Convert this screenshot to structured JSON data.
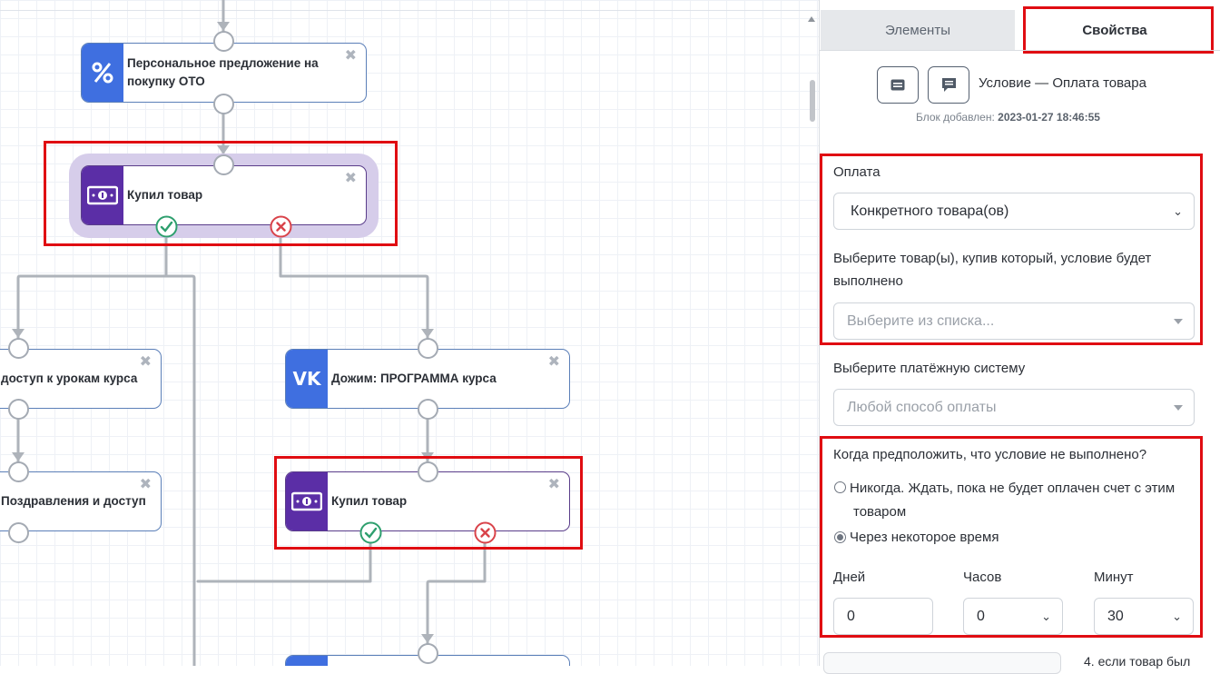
{
  "canvas": {
    "nodes": {
      "offer": {
        "title_line1": "Персональное предложение на",
        "title_line2": "покупку ОТО",
        "icon": "percent-icon"
      },
      "bought1": {
        "title": "Купил товар",
        "icon": "money-icon"
      },
      "access": {
        "title": "доступ к урокам курса"
      },
      "vk": {
        "title": "Дожим: ПРОГРАММА курса",
        "icon": "vk-icon"
      },
      "congrats": {
        "title": "Поздравления и доступ"
      },
      "bought2": {
        "title": "Купил товар",
        "icon": "money-icon"
      }
    },
    "close_glyph": "✖"
  },
  "panel": {
    "tabs": [
      "Элементы",
      "Свойства"
    ],
    "block_title": "Условие — Оплата товара",
    "added_label": "Блок добавлен:",
    "added_value": "2023-01-27 18:46:55",
    "payment_label": "Оплата",
    "payment_value": "Конкретного товара(ов)",
    "product_label": "Выберите товар(ы), купив который, условие будет выполнено",
    "product_placeholder": "Выберите из списка...",
    "system_label": "Выберите платёжную систему",
    "system_value": "Любой способ оплаты",
    "when_label": "Когда предположить, что условие не выполнено?",
    "option_never_line1": "Никогда. Ждать, пока не будет оплачен счет с этим",
    "option_never_line2": "товаром",
    "option_later": "Через некоторое время",
    "days_label": "Дней",
    "hours_label": "Часов",
    "minutes_label": "Минут",
    "days_value": "0",
    "hours_value": "0",
    "minutes_value": "30",
    "footer_text": "4. если товар был"
  },
  "colors": {
    "highlight": "#e00d12",
    "accent_blue": "#3f6fe0",
    "accent_violet": "#5b2ea6",
    "success": "#2e9f6e",
    "fail": "#d9434a"
  }
}
